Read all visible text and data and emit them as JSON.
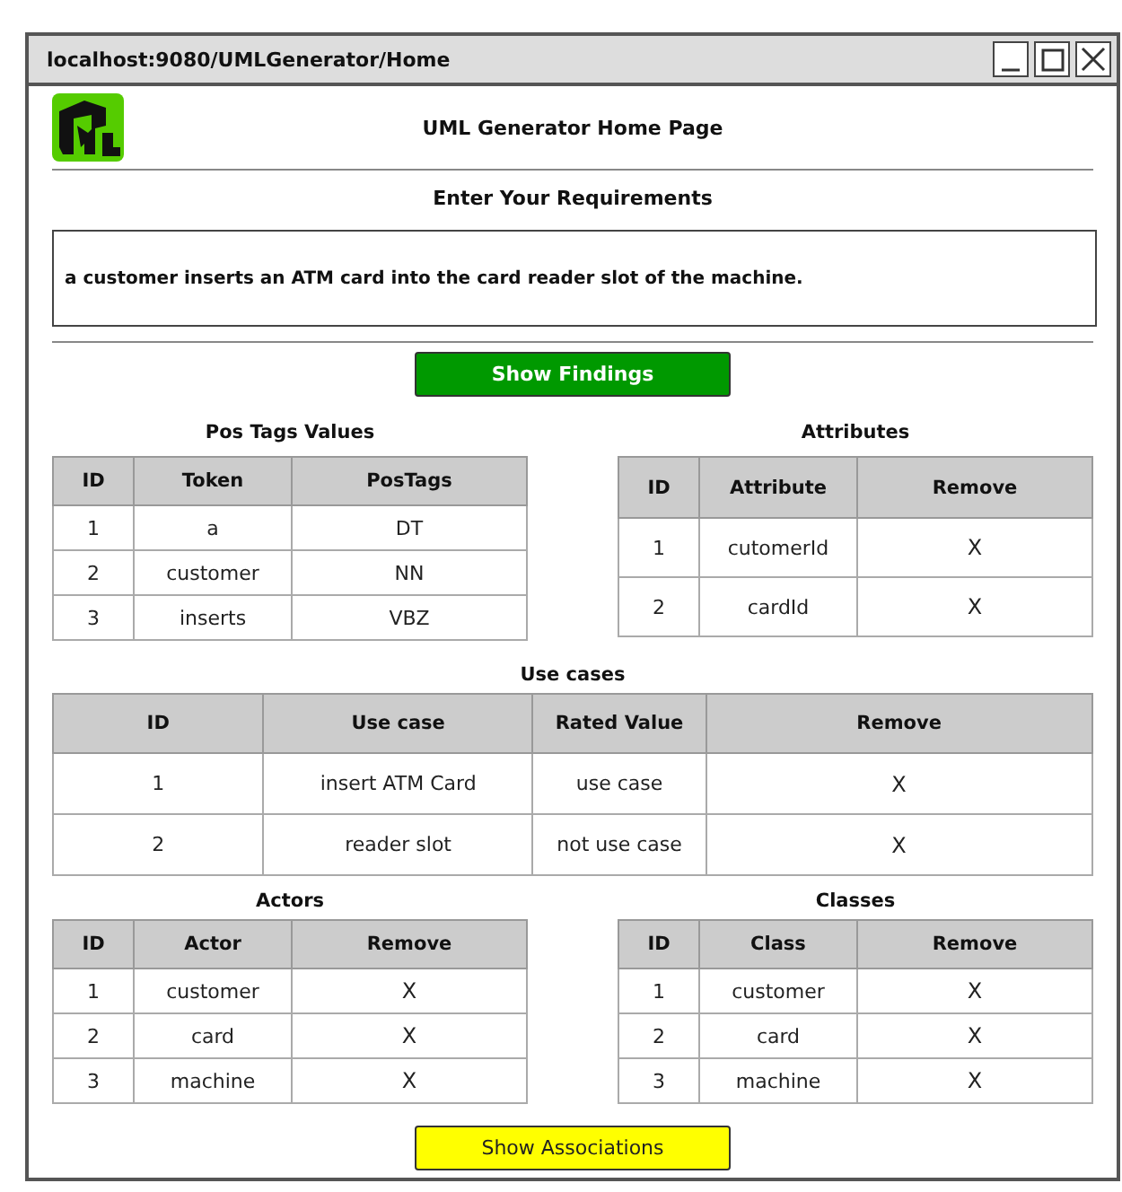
{
  "window": {
    "title": "localhost:9080/UMLGenerator/Home"
  },
  "header": {
    "title": "UML Generator Home Page"
  },
  "requirements": {
    "label": "Enter Your Requirements",
    "value": "a customer inserts an ATM card into the card reader slot of the machine."
  },
  "show_findings_button": {
    "label": "Show Findings"
  },
  "pos_tags": {
    "title": "Pos Tags Values",
    "columns": [
      {
        "label": "ID",
        "kind": "text"
      },
      {
        "label": "Token",
        "kind": "text"
      },
      {
        "label": "PosTags",
        "kind": "text"
      }
    ],
    "rows": [
      [
        "1",
        "a",
        "DT"
      ],
      [
        "2",
        "customer",
        "NN"
      ],
      [
        "3",
        "inserts",
        "VBZ"
      ]
    ]
  },
  "attributes": {
    "title": "Attributes",
    "columns": [
      {
        "label": "ID",
        "kind": "text"
      },
      {
        "label": "Attribute",
        "kind": "text"
      },
      {
        "label": "Remove",
        "kind": "action"
      }
    ],
    "rows": [
      [
        "1",
        "cutomerId",
        "X"
      ],
      [
        "2",
        "cardId",
        "X"
      ]
    ]
  },
  "use_cases": {
    "title": "Use cases",
    "columns": [
      {
        "label": "ID",
        "kind": "text"
      },
      {
        "label": "Use case",
        "kind": "text"
      },
      {
        "label": "Rated Value",
        "kind": "text"
      },
      {
        "label": "Remove",
        "kind": "action"
      }
    ],
    "rows": [
      [
        "1",
        "insert ATM Card",
        "use case",
        "X"
      ],
      [
        "2",
        "reader slot",
        "not use case",
        "X"
      ]
    ]
  },
  "actors": {
    "title": "Actors",
    "columns": [
      {
        "label": "ID",
        "kind": "text"
      },
      {
        "label": "Actor",
        "kind": "text"
      },
      {
        "label": "Remove",
        "kind": "action"
      }
    ],
    "rows": [
      [
        "1",
        "customer",
        "X"
      ],
      [
        "2",
        "card",
        "X"
      ],
      [
        "3",
        "machine",
        "X"
      ]
    ]
  },
  "classes": {
    "title": "Classes",
    "columns": [
      {
        "label": "ID",
        "kind": "text"
      },
      {
        "label": "Class",
        "kind": "text"
      },
      {
        "label": "Remove",
        "kind": "action"
      }
    ],
    "rows": [
      [
        "1",
        "customer",
        "X"
      ],
      [
        "2",
        "card",
        "X"
      ],
      [
        "3",
        "machine",
        "X"
      ]
    ]
  },
  "show_associations_button": {
    "label": "Show Associations"
  }
}
